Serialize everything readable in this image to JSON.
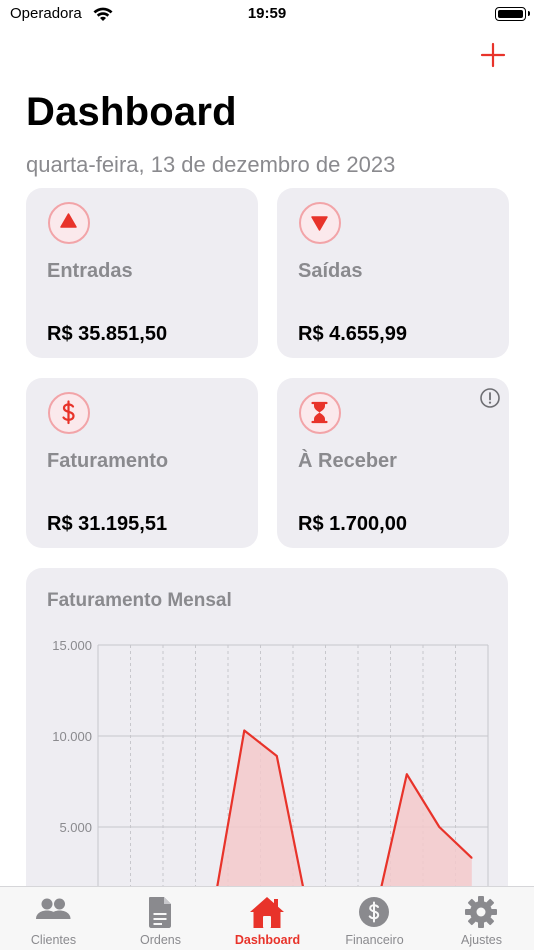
{
  "status_bar": {
    "carrier": "Operadora",
    "time": "19:59"
  },
  "header": {
    "title": "Dashboard",
    "date": "quarta-feira, 13 de dezembro de 2023",
    "add_icon": "plus-icon"
  },
  "colors": {
    "accent": "#e8332a",
    "card_bg": "#eeedf2",
    "muted": "#8a8a8e",
    "icon_ring": "#f2a4a8"
  },
  "cards": [
    {
      "label": "Entradas",
      "value": "R$ 35.851,50",
      "icon": "arrow-up-triangle-icon"
    },
    {
      "label": "Saídas",
      "value": "R$ 4.655,99",
      "icon": "arrow-down-triangle-icon"
    },
    {
      "label": "Faturamento",
      "value": "R$ 31.195,51",
      "icon": "dollar-icon"
    },
    {
      "label": "À Receber",
      "value": "R$ 1.700,00",
      "icon": "hourglass-icon",
      "badge_icon": "info-icon"
    }
  ],
  "chart": {
    "title": "Faturamento Mensal"
  },
  "chart_data": {
    "type": "area",
    "title": "Faturamento Mensal",
    "y_ticks": [
      "15.000",
      "10.000",
      "5.000"
    ],
    "ylim": [
      0,
      15000
    ],
    "grid": true,
    "x_count": 12,
    "values": [
      0,
      0,
      0,
      0,
      10300,
      8900,
      0,
      0,
      0,
      7900,
      5000,
      3300
    ],
    "line_color": "#e8332a",
    "fill_color": "#f3c9cb"
  },
  "tabs": [
    {
      "label": "Clientes",
      "icon": "people-icon",
      "active": false
    },
    {
      "label": "Ordens",
      "icon": "document-icon",
      "active": false
    },
    {
      "label": "Dashboard",
      "icon": "house-icon",
      "active": true
    },
    {
      "label": "Financeiro",
      "icon": "dollar-circle-icon",
      "active": false
    },
    {
      "label": "Ajustes",
      "icon": "gear-icon",
      "active": false
    }
  ]
}
